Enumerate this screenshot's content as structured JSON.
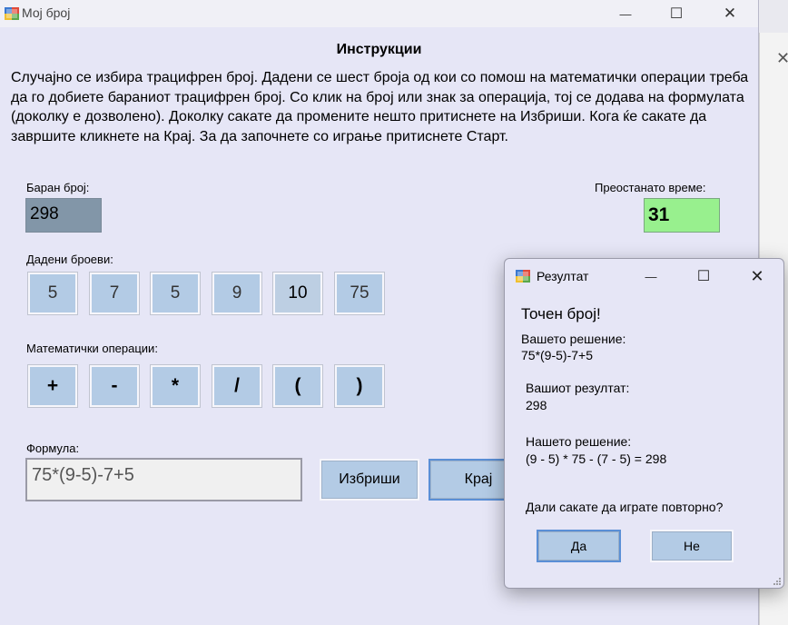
{
  "background_window": {
    "close_glyph": "✕"
  },
  "main_window": {
    "title": "Мој број",
    "controls": {
      "minimize": "—",
      "maximize": "☐",
      "close": "✕"
    },
    "heading": "Инструкции",
    "instructions": "Случајно се избира трацифрен број. Дадени се шест броја од кои со помош на математички операции треба да го добиете бараниот трацифрен број. Со клик на број или знак за операција, тој се додава на формулата (доколку е дозволено). Доколку сакате да промените нешто притиснете на Избриши. Кога ќе сакате да завршите кликнете на Крај. За да започнете со играње притиснете Старт.",
    "target_label": "Баран број:",
    "target_value": "298",
    "time_label": "Преостанато време:",
    "time_value": "31",
    "numbers_label": "Дадени броеви:",
    "numbers": [
      "5",
      "7",
      "5",
      "9",
      "10",
      "75"
    ],
    "operations_label": "Математички операции:",
    "operations": [
      "+",
      "-",
      "*",
      "/",
      "(",
      ")"
    ],
    "formula_label": "Формула:",
    "formula_value": "75*(9-5)-7+5",
    "clear_button": "Избриши",
    "end_button": "Крај"
  },
  "result_dialog": {
    "title": "Резултат",
    "controls": {
      "minimize": "—",
      "maximize": "☐",
      "close": "✕"
    },
    "status": "Точен број!",
    "your_solution_label": "Вашето решение:",
    "your_solution": "75*(9-5)-7+5",
    "your_result_label": "Вашиот резултат:",
    "your_result": "298",
    "our_solution_label": "Нашето решение:",
    "our_solution": "(9 - 5) * 75 - (7 - 5) = 298",
    "question": "Дали сакате да играте повторно?",
    "yes_button": "Да",
    "no_button": "Не"
  },
  "colors": {
    "form_background": "#e6e6f6",
    "button_fill": "#b3cbe5",
    "target_fill": "#8296a8",
    "timer_fill": "#98f08e"
  }
}
